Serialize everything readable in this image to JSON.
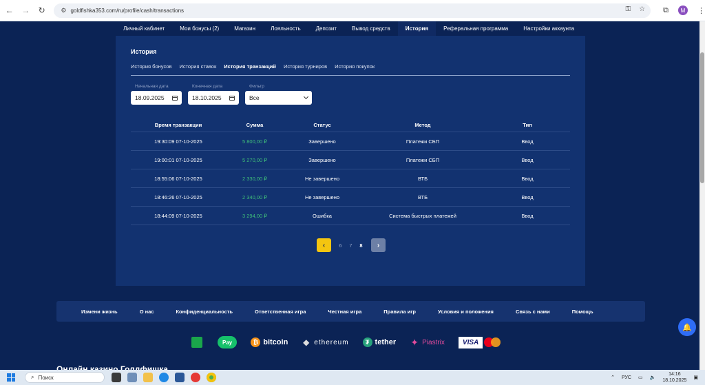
{
  "browser": {
    "url": "goldfishka353.com/ru/profile/cash/transactions",
    "avatar_letter": "M"
  },
  "profile_tabs": [
    {
      "label": "Личный кабинет",
      "active": false
    },
    {
      "label": "Мои бонусы  (2)",
      "active": false
    },
    {
      "label": "Магазин",
      "active": false
    },
    {
      "label": "Лояльность",
      "active": false
    },
    {
      "label": "Депозит",
      "active": false
    },
    {
      "label": "Вывод средств",
      "active": false
    },
    {
      "label": "История",
      "active": true
    },
    {
      "label": "Реферальная программа",
      "active": false
    },
    {
      "label": "Настройки аккаунта",
      "active": false
    }
  ],
  "history": {
    "title": "История",
    "sub_tabs": [
      {
        "label": "История бонусов",
        "active": false
      },
      {
        "label": "История ставок",
        "active": false
      },
      {
        "label": "История транзакций",
        "active": true
      },
      {
        "label": "История турниров",
        "active": false
      },
      {
        "label": "История покупок",
        "active": false
      }
    ],
    "filters": {
      "start_label": "Начальная дата",
      "start_value": "18.09.2025",
      "end_label": "Конечная дата",
      "end_value": "18.10.2025",
      "filter_label": "Фильтр",
      "filter_value": "Все"
    },
    "columns": [
      "Время транзакции",
      "Сумма",
      "Статус",
      "Метод",
      "Тип"
    ],
    "rows": [
      {
        "time": "19:30:09 07-10-2025",
        "amount": "5 800,00 ₽",
        "status": "Завершено",
        "method": "Платежи СБП",
        "type": "Ввод"
      },
      {
        "time": "19:00:01 07-10-2025",
        "amount": "5 270,00 ₽",
        "status": "Завершено",
        "method": "Платежи СБП",
        "type": "Ввод"
      },
      {
        "time": "18:55:06 07-10-2025",
        "amount": "2 330,00 ₽",
        "status": "Не завершено",
        "method": "ВТБ",
        "type": "Ввод"
      },
      {
        "time": "18:46:26 07-10-2025",
        "amount": "2 340,00 ₽",
        "status": "Не завершено",
        "method": "ВТБ",
        "type": "Ввод"
      },
      {
        "time": "18:44:09 07-10-2025",
        "amount": "3 294,00 ₽",
        "status": "Ошибка",
        "method": "Система быстрых платежей",
        "type": "Ввод"
      }
    ],
    "pagination": {
      "prev": "‹",
      "next": "›",
      "pages": [
        {
          "label": "6",
          "current": false
        },
        {
          "label": "7",
          "current": false
        },
        {
          "label": "8",
          "current": true
        }
      ]
    }
  },
  "footer_links": [
    "Измени жизнь",
    "О нас",
    "Конфиденциальность",
    "Ответственная игра",
    "Честная игра",
    "Правила игр",
    "Условия и положения",
    "Связь с нами",
    "Помощь"
  ],
  "payments": {
    "spay": "Pay",
    "bitcoin": "bitcoin",
    "ethereum": "ethereum",
    "tether": "tether",
    "piastrix": "Piastrix",
    "visa": "VISA"
  },
  "partial_heading": "Онлайн казино Голдфишка",
  "taskbar": {
    "search_placeholder": "Поиск",
    "lang": "РУС",
    "time": "14:16",
    "date": "18.10.2025"
  },
  "colors": {
    "page_bg": "#0b2355",
    "panel_bg": "#123270",
    "amount_green": "#3fbf7a",
    "pager_active": "#f4c510",
    "bell_blue": "#2f6df6"
  }
}
